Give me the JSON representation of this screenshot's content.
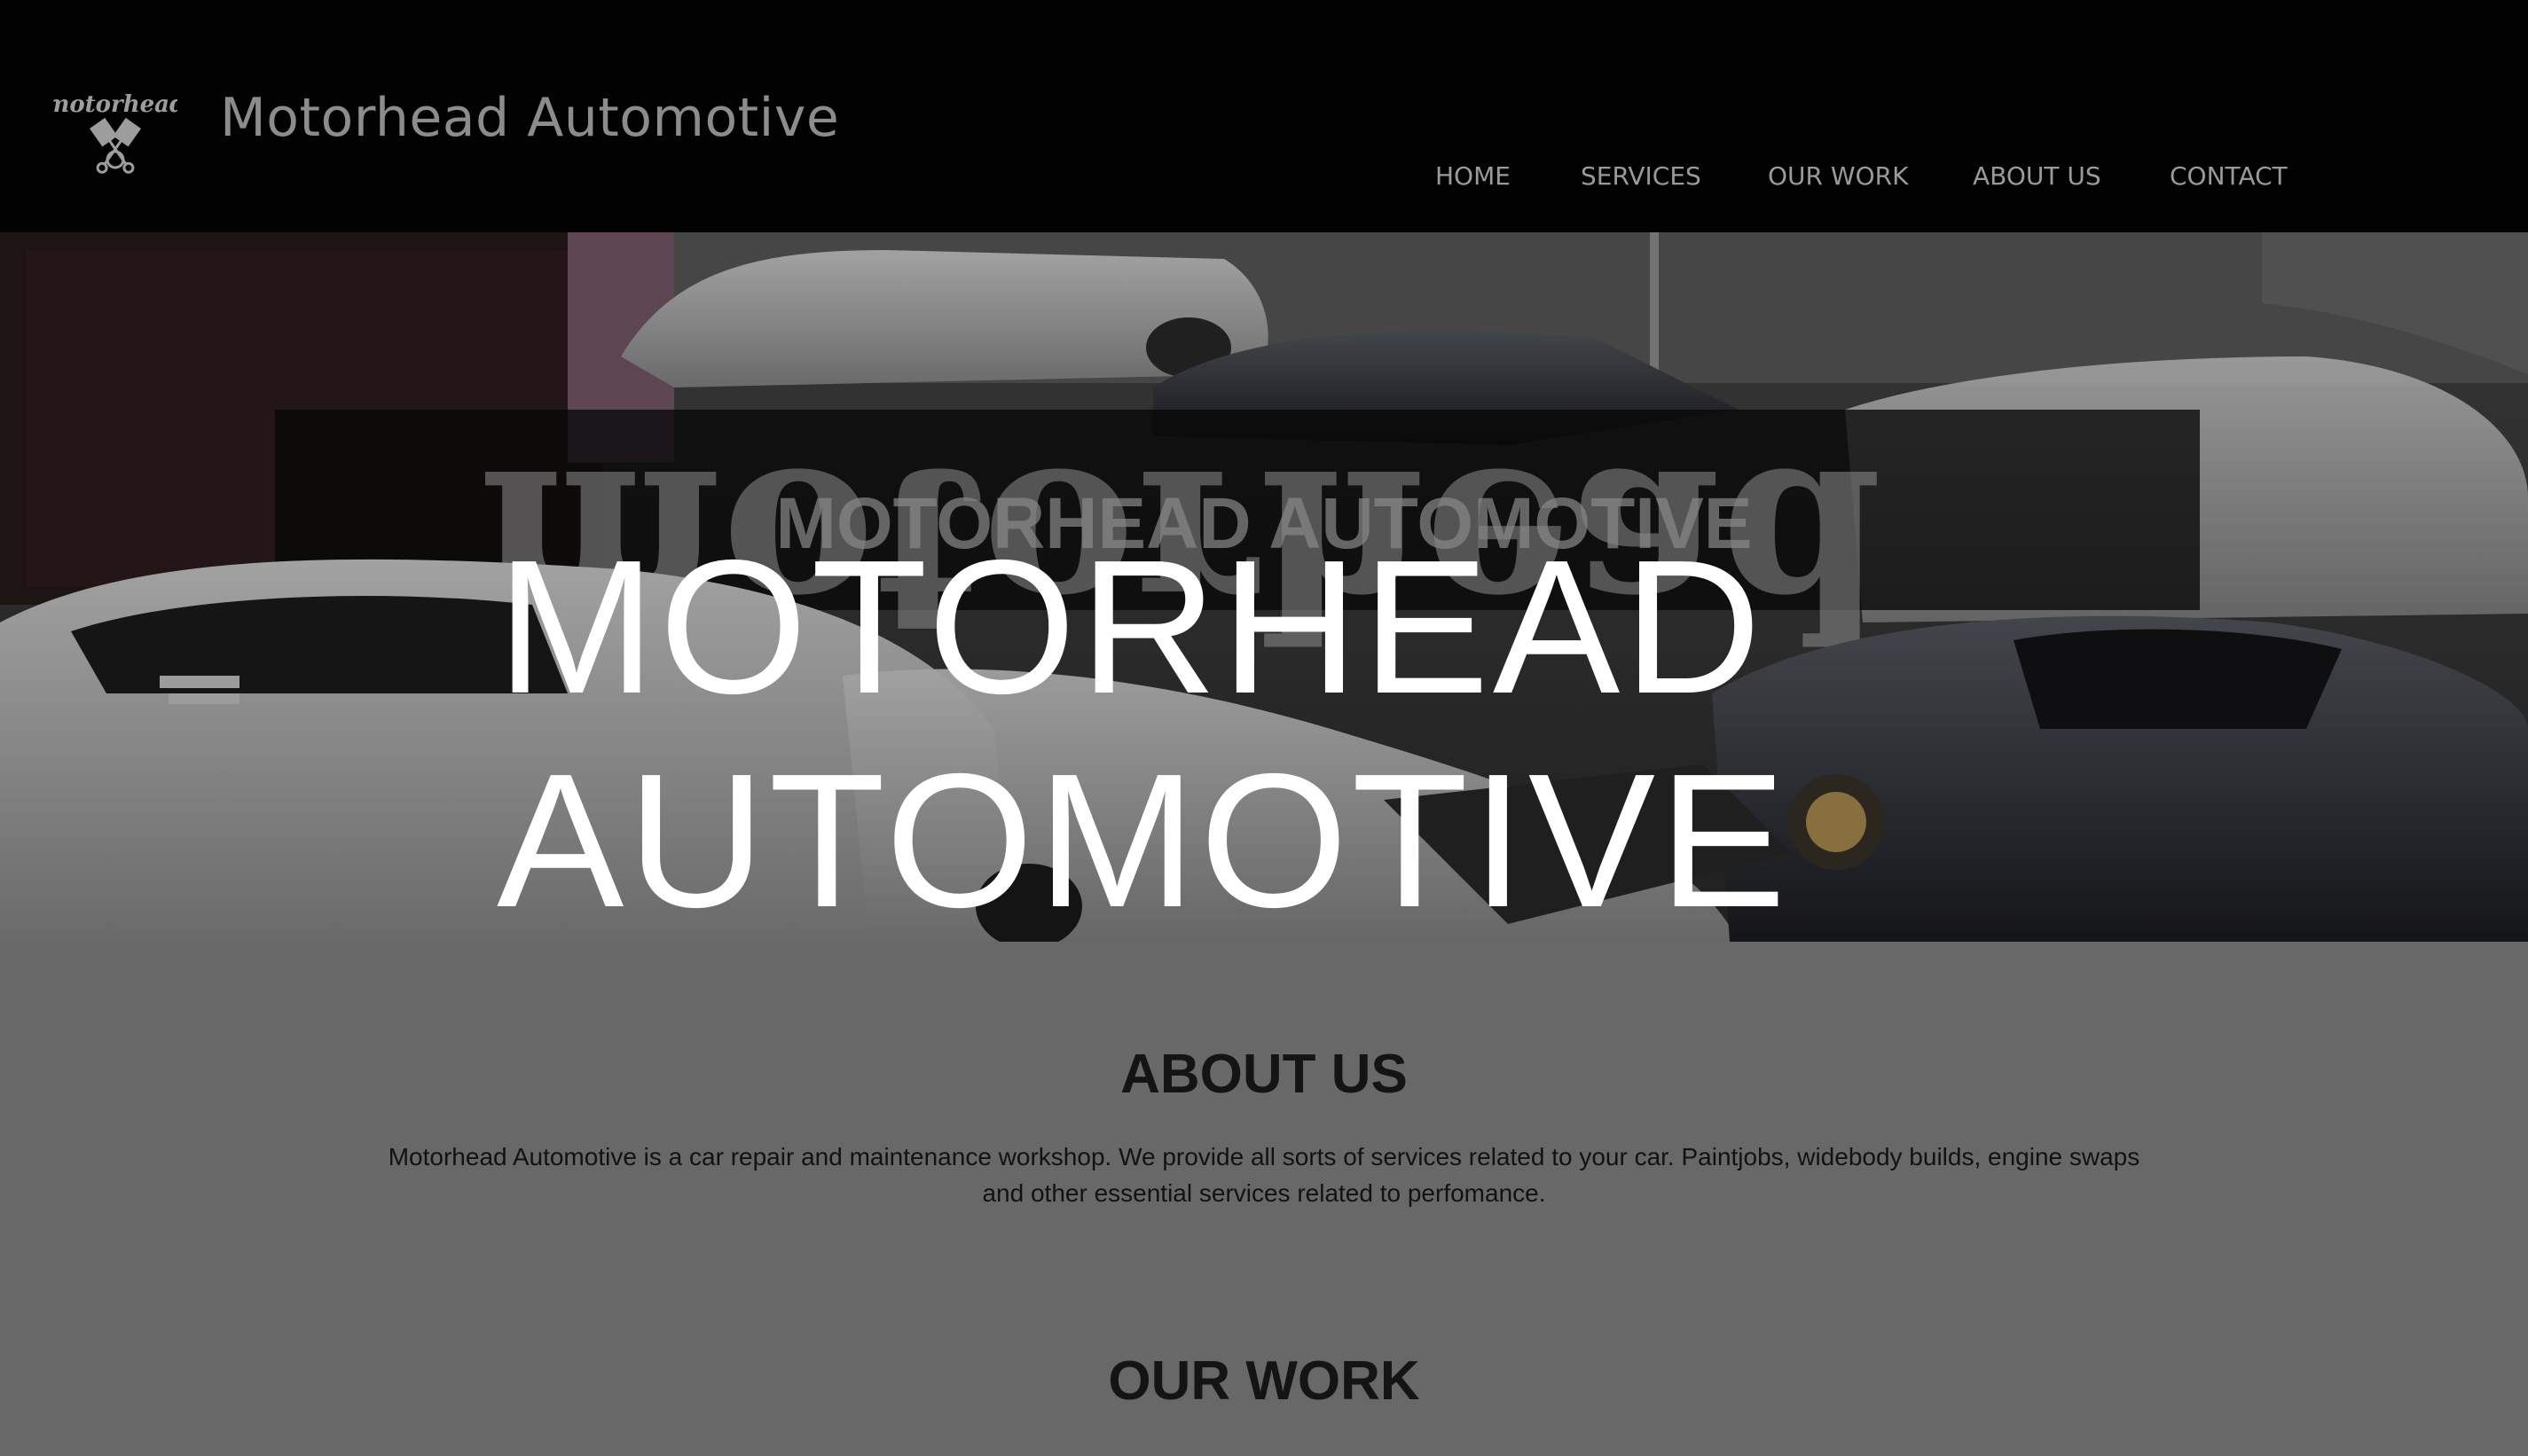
{
  "header": {
    "brand": "Motorhead Automotive",
    "logo_text": "motorhead",
    "logo_icon": "crossed-pistons-icon",
    "nav": [
      "HOME",
      "SERVICES",
      "OUR WORK",
      "ABOUT US",
      "CONTACT"
    ]
  },
  "hero": {
    "banner_text": "MOTORHEAD AUTOMOTIVE",
    "title_line1": "MOTORHEAD",
    "title_line2": "AUTOMOTIVE"
  },
  "about": {
    "heading": "ABOUT US",
    "text": "Motorhead Automotive is a car repair and maintenance workshop. We provide all sorts of services related to your car. Paintjobs, widebody builds, engine swaps and other essential services related to perfomance."
  },
  "work": {
    "heading": "OUR WORK"
  },
  "colors": {
    "header_bg": "#020202",
    "page_bg": "#686868",
    "hero_text": "#ffffff",
    "nav_text": "#9a9a9a"
  }
}
